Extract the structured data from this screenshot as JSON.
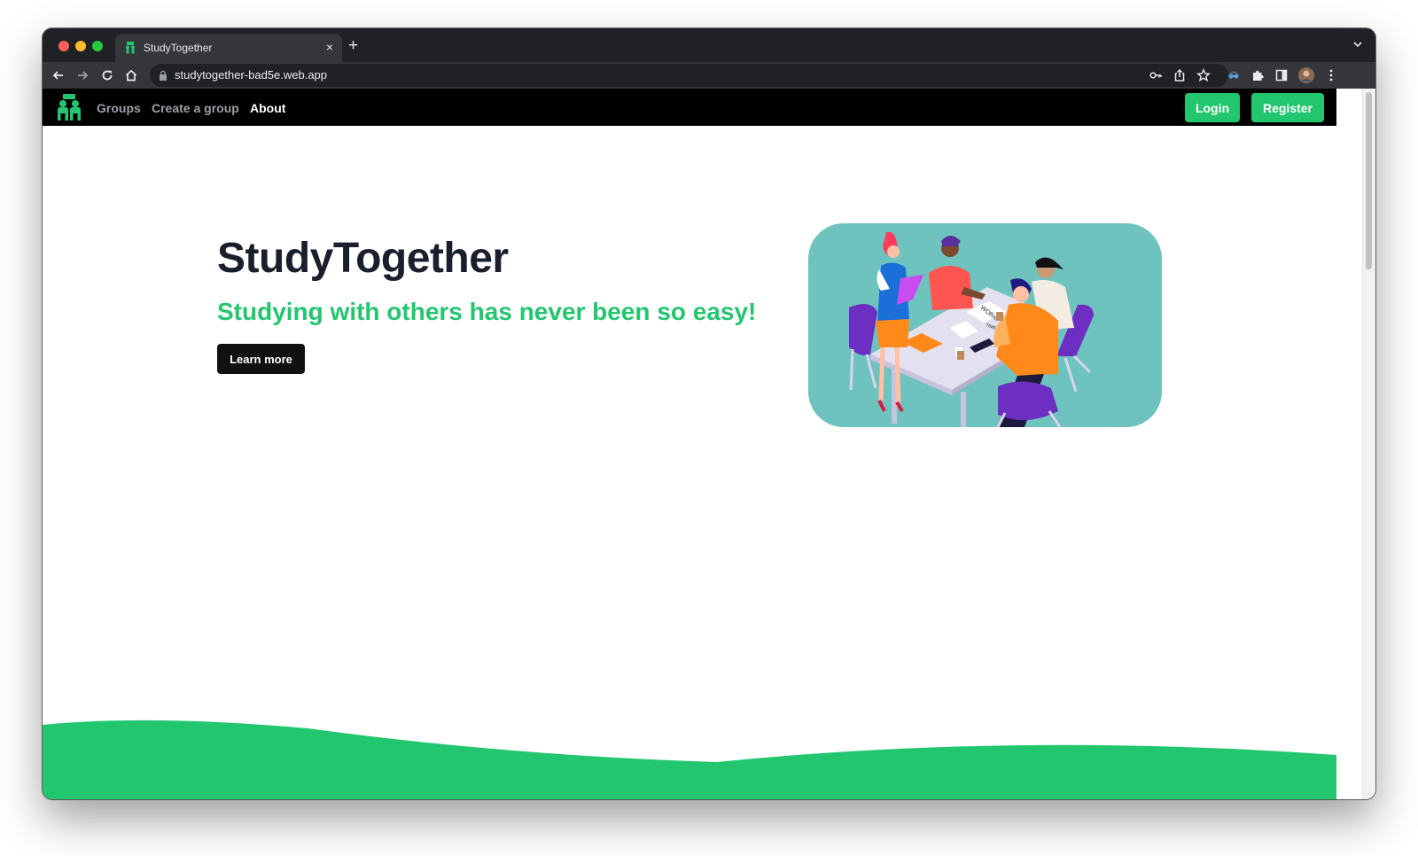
{
  "browser": {
    "tab_title": "StudyTogether",
    "tab_close": "×",
    "new_tab": "+",
    "url": "studytogether-bad5e.web.app"
  },
  "nav": {
    "links": [
      "Groups",
      "Create a group",
      "About"
    ],
    "active": "About",
    "login_label": "Login",
    "register_label": "Register"
  },
  "hero": {
    "title": "StudyTogether",
    "subtitle": "Studying with others has never been so easy!",
    "cta_label": "Learn more",
    "image_labels": [
      "WORK",
      "TIME LINE"
    ]
  },
  "colors": {
    "brand_green": "#22c66f",
    "nav_bg": "#000000",
    "title_dark": "#1a1f2e",
    "illustration_bg": "#6ec3bf"
  },
  "icons": [
    "back-icon",
    "forward-icon",
    "reload-icon",
    "home-icon",
    "lock-icon",
    "key-icon",
    "share-icon",
    "star-icon",
    "extension-spy-icon",
    "puzzle-icon",
    "sidepanel-icon",
    "profile-avatar",
    "kebab-menu-icon",
    "chevron-down-icon",
    "studytogether-logo"
  ]
}
